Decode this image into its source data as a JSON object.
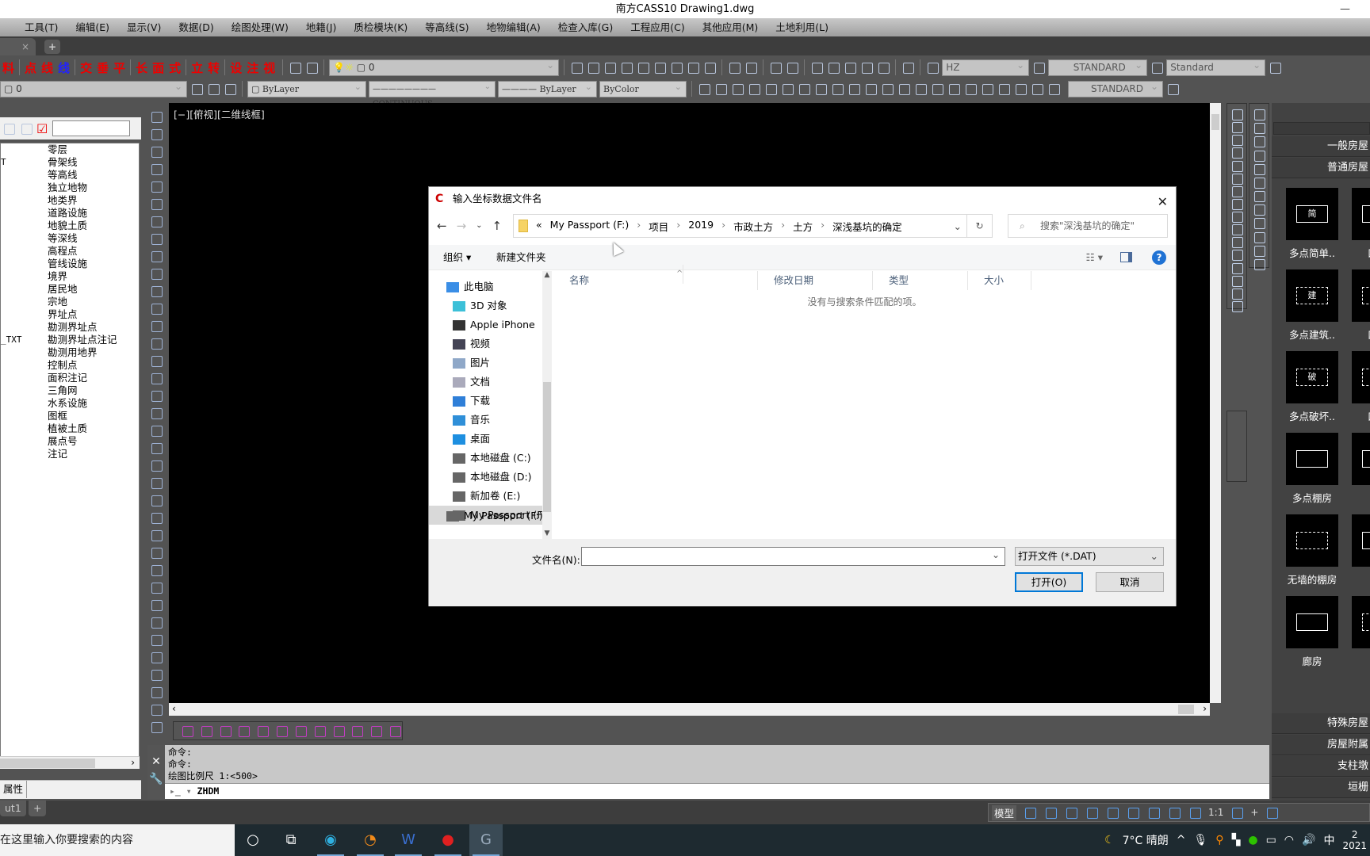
{
  "window": {
    "title": "南方CASS10    Drawing1.dwg",
    "minimize": "—"
  },
  "menu": [
    "工具(T)",
    "编辑(E)",
    "显示(V)",
    "数据(D)",
    "绘图处理(W)",
    "地籍(J)",
    "质检模块(K)",
    "等高线(S)",
    "地物编辑(A)",
    "检查入库(G)",
    "工程应用(C)",
    "其他应用(M)",
    "土地利用(L)"
  ],
  "tabs": {
    "close": "×",
    "add": "+"
  },
  "toolbar": {
    "cass_buttons": [
      {
        "t": "料",
        "c": "red"
      },
      {
        "t": "点",
        "c": "red"
      },
      {
        "t": "线",
        "c": "red"
      },
      {
        "t": "线",
        "c": "blue"
      },
      {
        "t": "交",
        "c": "red"
      },
      {
        "t": "垂",
        "c": "red"
      },
      {
        "t": "平",
        "c": "red"
      },
      {
        "t": "长",
        "c": "red"
      },
      {
        "t": "面",
        "c": "red"
      },
      {
        "t": "式",
        "c": "red"
      },
      {
        "t": "立",
        "c": "red"
      },
      {
        "t": "转",
        "c": "red"
      },
      {
        "t": "设",
        "c": "red"
      },
      {
        "t": "注",
        "c": "red"
      },
      {
        "t": "视",
        "c": "red"
      }
    ],
    "layer_state": "0",
    "layer_combo": "0",
    "color_combo": "ByLayer",
    "linetype_combo": "CONTINUOUS",
    "lineweight_combo": "ByLayer",
    "plotstyle_combo": "ByColor",
    "text_style": "HZ",
    "dim_style": "STANDARD",
    "table_style": "Standard",
    "dim_style2": "STANDARD"
  },
  "left_panel": {
    "layers": [
      {
        "c1": "",
        "c2": "零层"
      },
      {
        "c1": "T",
        "c2": "骨架线"
      },
      {
        "c1": "",
        "c2": "等高线"
      },
      {
        "c1": "",
        "c2": "独立地物"
      },
      {
        "c1": "",
        "c2": "地类界"
      },
      {
        "c1": "",
        "c2": "道路设施"
      },
      {
        "c1": "",
        "c2": "地貌土质"
      },
      {
        "c1": "",
        "c2": "等深线"
      },
      {
        "c1": "",
        "c2": "高程点"
      },
      {
        "c1": "",
        "c2": "管线设施"
      },
      {
        "c1": "",
        "c2": "境界"
      },
      {
        "c1": "",
        "c2": "居民地"
      },
      {
        "c1": "",
        "c2": "宗地"
      },
      {
        "c1": "",
        "c2": "界址点"
      },
      {
        "c1": "",
        "c2": "勘测界址点"
      },
      {
        "c1": "_TXT",
        "c2": "勘测界址点注记"
      },
      {
        "c1": "",
        "c2": "勘测用地界"
      },
      {
        "c1": "",
        "c2": "控制点"
      },
      {
        "c1": "",
        "c2": "面积注记"
      },
      {
        "c1": "",
        "c2": "三角网"
      },
      {
        "c1": "",
        "c2": "水系设施"
      },
      {
        "c1": "",
        "c2": "图框"
      },
      {
        "c1": "",
        "c2": "植被土质"
      },
      {
        "c1": "",
        "c2": "展点号"
      },
      {
        "c1": "",
        "c2": "注记"
      }
    ],
    "tab": "属性"
  },
  "viewport_label": "[−][俯视][二维线框]",
  "command": {
    "lines": [
      "命令:",
      "命令:",
      "绘图比例尺 1:<500>"
    ],
    "input": "ZHDM"
  },
  "layout_tabs": [
    "ut1",
    "+"
  ],
  "status": {
    "model": "模型",
    "scale": "1:1"
  },
  "taskbar": {
    "search_placeholder": "在这里输入你要搜索的内容",
    "weather": "7°C  晴朗",
    "ime": "中",
    "clock": "2",
    "date": "2021"
  },
  "palette": {
    "header_top": "一般房屋",
    "header_sub": "普通房屋",
    "items": [
      {
        "label": "多点简单..",
        "style": "solid",
        "mark": "简"
      },
      {
        "label": "四点",
        "style": "solid",
        "mark": ""
      },
      {
        "label": "多点建筑..",
        "style": "dashed",
        "mark": "建"
      },
      {
        "label": "四点",
        "style": "dashed",
        "mark": ""
      },
      {
        "label": "多点破坏..",
        "style": "dashed",
        "mark": "破"
      },
      {
        "label": "四点",
        "style": "dashed",
        "mark": ""
      },
      {
        "label": "多点棚房",
        "style": "solid",
        "mark": ""
      },
      {
        "label": "四",
        "style": "solid",
        "mark": ""
      },
      {
        "label": "无墙的棚房",
        "style": "dashed",
        "mark": ""
      },
      {
        "label": "架",
        "style": "solid",
        "mark": ""
      },
      {
        "label": "廊房",
        "style": "solid",
        "mark": ""
      },
      {
        "label": "",
        "style": "dashed",
        "mark": ""
      }
    ],
    "sections": [
      "特殊房屋",
      "房屋附属",
      "支柱墩",
      "垣栅"
    ]
  },
  "dialog": {
    "title": "输入坐标数据文件名",
    "close": "✕",
    "breadcrumb": [
      "«",
      "My Passport (F:)",
      "项目",
      "2019",
      "市政土方",
      "土方",
      "深浅基坑的确定"
    ],
    "search_placeholder": "搜索\"深浅基坑的确定\"",
    "organize": "组织 ▾",
    "new_folder": "新建文件夹",
    "help": "?",
    "nav": [
      {
        "label": "此电脑",
        "icon": "pc-icon",
        "color": "#3a8ee6"
      },
      {
        "label": "3D 对象",
        "icon": "3d-objects-icon",
        "color": "#3cc0d8"
      },
      {
        "label": "Apple iPhone",
        "icon": "phone-icon",
        "color": "#333"
      },
      {
        "label": "视频",
        "icon": "video-icon",
        "color": "#445"
      },
      {
        "label": "图片",
        "icon": "pictures-icon",
        "color": "#8fa8c8"
      },
      {
        "label": "文档",
        "icon": "documents-icon",
        "color": "#aab"
      },
      {
        "label": "下载",
        "icon": "download-icon",
        "color": "#2f7fd8"
      },
      {
        "label": "音乐",
        "icon": "music-icon",
        "color": "#2f8fd8"
      },
      {
        "label": "桌面",
        "icon": "desktop-icon",
        "color": "#1e8fe0"
      },
      {
        "label": "本地磁盘 (C:)",
        "icon": "drive-icon",
        "color": "#666"
      },
      {
        "label": "本地磁盘 (D:)",
        "icon": "drive-icon",
        "color": "#666"
      },
      {
        "label": "新加卷 (E:)",
        "icon": "drive-icon",
        "color": "#666"
      },
      {
        "label": "My Passport (F:)",
        "icon": "drive-icon",
        "color": "#666",
        "selected": true
      },
      {
        "label": "My Passport (F:)",
        "icon": "drive-icon",
        "color": "#666"
      }
    ],
    "columns": [
      "名称",
      "修改日期",
      "类型",
      "大小"
    ],
    "empty_message": "没有与搜索条件匹配的项。",
    "filename_label": "文件名(N):",
    "filename_value": "",
    "filetype": "打开文件 (*.DAT)",
    "open": "打开(O)",
    "cancel": "取消"
  }
}
